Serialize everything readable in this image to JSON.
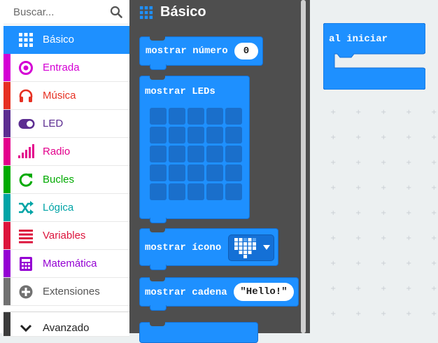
{
  "search": {
    "placeholder": "Buscar..."
  },
  "categories": [
    {
      "label": "Básico",
      "color": "#1e90ff",
      "icon": "grid-icon",
      "selected": true
    },
    {
      "label": "Entrada",
      "color": "#d400d4",
      "icon": "target-icon"
    },
    {
      "label": "Música",
      "color": "#e63022",
      "icon": "headphones-icon"
    },
    {
      "label": "LED",
      "color": "#5c2d91",
      "icon": "toggle-icon"
    },
    {
      "label": "Radio",
      "color": "#e3008c",
      "icon": "signal-bars-icon"
    },
    {
      "label": "Bucles",
      "color": "#00aa00",
      "icon": "refresh-icon"
    },
    {
      "label": "Lógica",
      "color": "#00a4a6",
      "icon": "shuffle-icon"
    },
    {
      "label": "Variables",
      "color": "#dc143c",
      "icon": "list-lines-icon"
    },
    {
      "label": "Matemática",
      "color": "#9400d3",
      "icon": "calculator-icon"
    },
    {
      "label": "Extensiones",
      "color": "#717171",
      "icon": "plus-circle-icon"
    },
    {
      "label": "Avanzado",
      "color": "#3c3c3c",
      "icon": "chevron-down-icon"
    }
  ],
  "flyout": {
    "title": "Básico",
    "blocks": {
      "show_number": {
        "label": "mostrar número",
        "value": "0"
      },
      "show_leds": {
        "label": "mostrar LEDs"
      },
      "show_icon": {
        "label": "mostrar ícono"
      },
      "show_string": {
        "label": "mostrar cadena",
        "value": "\"Hello!\""
      }
    }
  },
  "workspace": {
    "on_start": {
      "label": "al iniciar"
    }
  },
  "colors": {
    "accent": "#1e90ff",
    "flyout_bg": "#4e4e4e",
    "workspace_bg": "#ecf0f1"
  }
}
